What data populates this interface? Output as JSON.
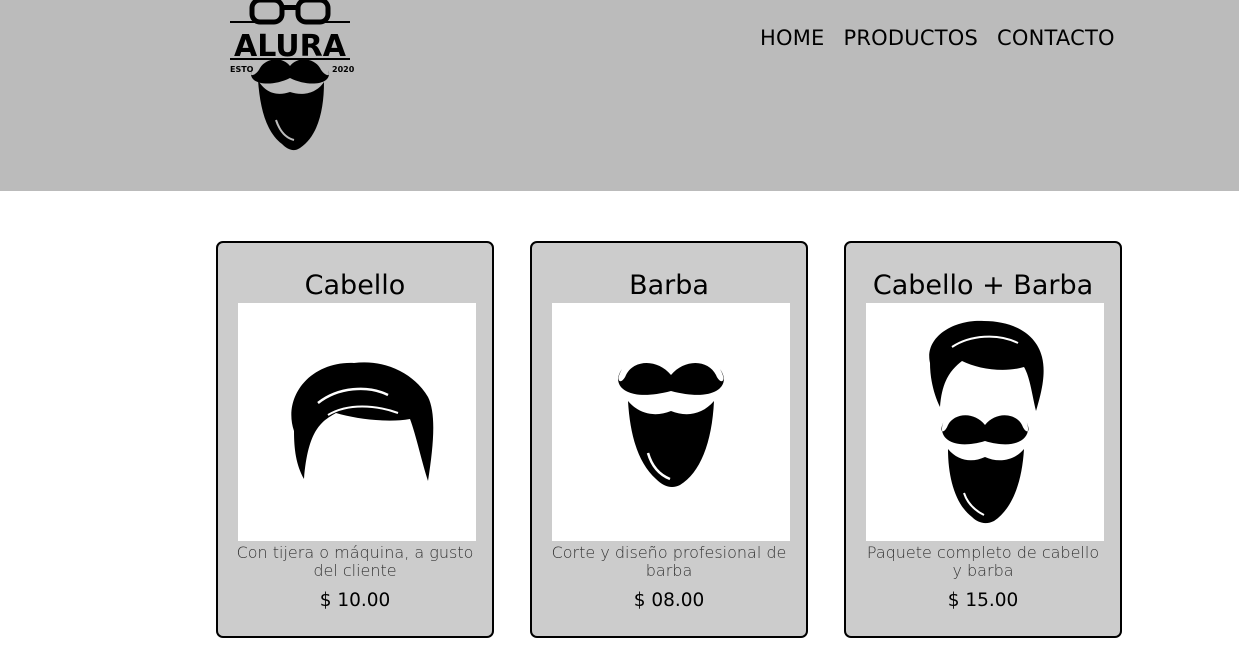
{
  "header": {
    "logo": {
      "brand": "ALURA",
      "left_text": "ESTO",
      "right_text": "2020"
    },
    "nav": [
      "HOME",
      "PRODUCTOS",
      "CONTACTO"
    ]
  },
  "products": [
    {
      "title": "Cabello",
      "image": "hair-illustration",
      "description": "Con tijera o máquina, a gusto del cliente",
      "price": "$ 10.00"
    },
    {
      "title": "Barba",
      "image": "beard-illustration",
      "description": "Corte y diseño profesional de barba",
      "price": "$ 08.00"
    },
    {
      "title": "Cabello + Barba",
      "image": "hair-and-beard-illustration",
      "description": "Paquete completo de cabello y barba",
      "price": "$ 15.00"
    }
  ]
}
